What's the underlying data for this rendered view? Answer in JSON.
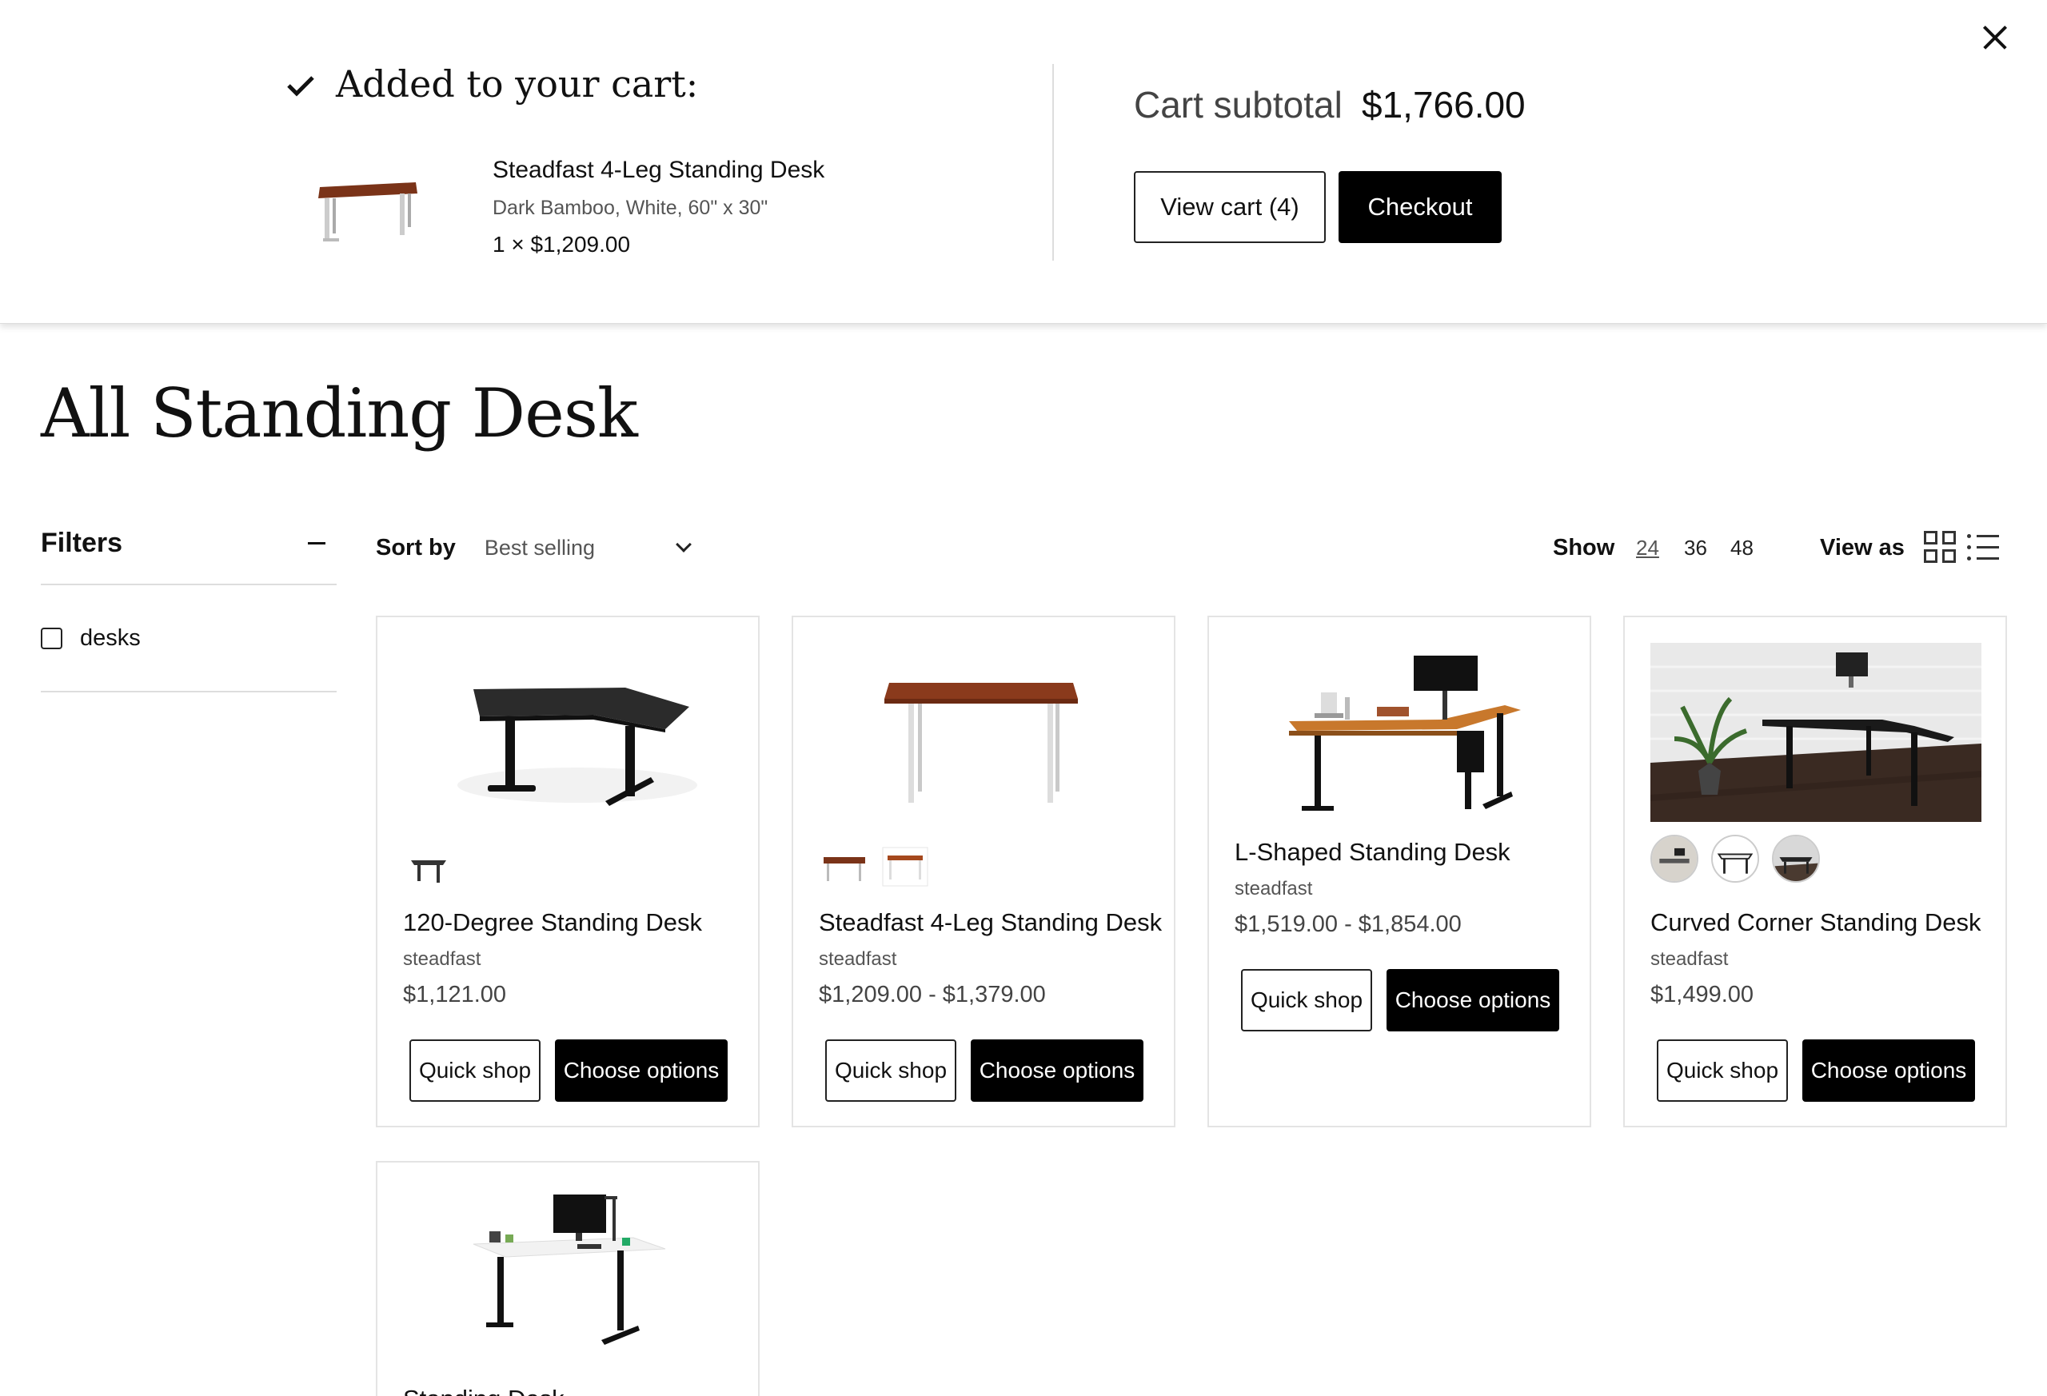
{
  "overlay": {
    "added_title": "Added to your cart:",
    "item": {
      "name": "Steadfast 4-Leg Standing Desk",
      "variant": "Dark Bamboo, White, 60\" x 30\"",
      "qty_price": "1 × $1,209.00"
    },
    "subtotal_label": "Cart subtotal",
    "subtotal_value": "$1,766.00",
    "view_cart_label": "View cart (4)",
    "checkout_label": "Checkout",
    "icons": {
      "check": "checkmark-icon",
      "close": "close-icon"
    }
  },
  "page": {
    "title": "All Standing Desk"
  },
  "filters": {
    "title": "Filters",
    "items": [
      {
        "label": "desks",
        "checked": false
      }
    ]
  },
  "toolbar": {
    "sort_label": "Sort by",
    "sort_value": "Best selling",
    "show_label": "Show",
    "show_options": [
      "24",
      "36",
      "48"
    ],
    "show_selected": "24",
    "view_as_label": "View as",
    "icons": {
      "grid": "grid-view-icon",
      "list": "list-view-icon",
      "chevron": "chevron-down-icon"
    }
  },
  "products": [
    {
      "name": "120-Degree Standing Desk",
      "vendor": "steadfast",
      "price": "$1,121.00",
      "quick_label": "Quick shop",
      "options_label": "Choose options"
    },
    {
      "name": "Steadfast 4-Leg Standing Desk",
      "vendor": "steadfast",
      "price": "$1,209.00 - $1,379.00",
      "quick_label": "Quick shop",
      "options_label": "Choose options"
    },
    {
      "name": "L-Shaped Standing Desk",
      "vendor": "steadfast",
      "price": "$1,519.00 - $1,854.00",
      "quick_label": "Quick shop",
      "options_label": "Choose options"
    },
    {
      "name": "Curved Corner Standing Desk",
      "vendor": "steadfast",
      "price": "$1,499.00",
      "quick_label": "Quick shop",
      "options_label": "Choose options"
    },
    {
      "name": "Standing Desk"
    }
  ],
  "colors": {
    "accent": "#000000",
    "border": "#e4e4e4",
    "text_muted": "#555555"
  }
}
